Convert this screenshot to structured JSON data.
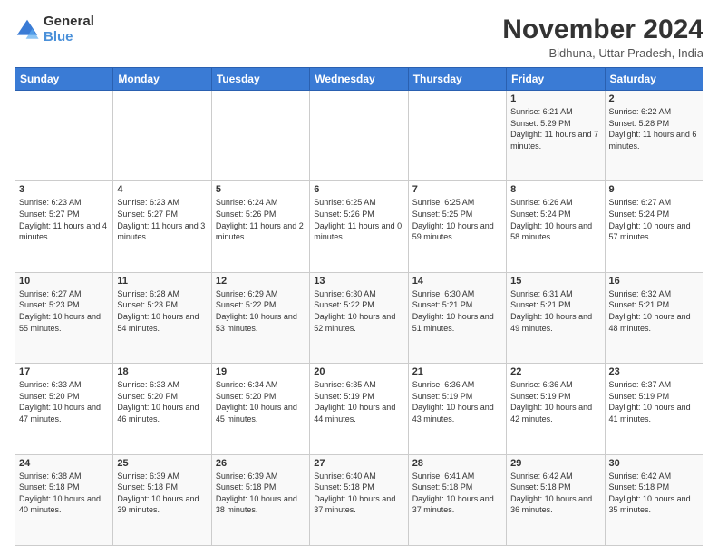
{
  "logo": {
    "general": "General",
    "blue": "Blue"
  },
  "title": "November 2024",
  "location": "Bidhuna, Uttar Pradesh, India",
  "days_of_week": [
    "Sunday",
    "Monday",
    "Tuesday",
    "Wednesday",
    "Thursday",
    "Friday",
    "Saturday"
  ],
  "weeks": [
    [
      {
        "day": "",
        "info": ""
      },
      {
        "day": "",
        "info": ""
      },
      {
        "day": "",
        "info": ""
      },
      {
        "day": "",
        "info": ""
      },
      {
        "day": "",
        "info": ""
      },
      {
        "day": "1",
        "info": "Sunrise: 6:21 AM\nSunset: 5:29 PM\nDaylight: 11 hours and 7 minutes."
      },
      {
        "day": "2",
        "info": "Sunrise: 6:22 AM\nSunset: 5:28 PM\nDaylight: 11 hours and 6 minutes."
      }
    ],
    [
      {
        "day": "3",
        "info": "Sunrise: 6:23 AM\nSunset: 5:27 PM\nDaylight: 11 hours and 4 minutes."
      },
      {
        "day": "4",
        "info": "Sunrise: 6:23 AM\nSunset: 5:27 PM\nDaylight: 11 hours and 3 minutes."
      },
      {
        "day": "5",
        "info": "Sunrise: 6:24 AM\nSunset: 5:26 PM\nDaylight: 11 hours and 2 minutes."
      },
      {
        "day": "6",
        "info": "Sunrise: 6:25 AM\nSunset: 5:26 PM\nDaylight: 11 hours and 0 minutes."
      },
      {
        "day": "7",
        "info": "Sunrise: 6:25 AM\nSunset: 5:25 PM\nDaylight: 10 hours and 59 minutes."
      },
      {
        "day": "8",
        "info": "Sunrise: 6:26 AM\nSunset: 5:24 PM\nDaylight: 10 hours and 58 minutes."
      },
      {
        "day": "9",
        "info": "Sunrise: 6:27 AM\nSunset: 5:24 PM\nDaylight: 10 hours and 57 minutes."
      }
    ],
    [
      {
        "day": "10",
        "info": "Sunrise: 6:27 AM\nSunset: 5:23 PM\nDaylight: 10 hours and 55 minutes."
      },
      {
        "day": "11",
        "info": "Sunrise: 6:28 AM\nSunset: 5:23 PM\nDaylight: 10 hours and 54 minutes."
      },
      {
        "day": "12",
        "info": "Sunrise: 6:29 AM\nSunset: 5:22 PM\nDaylight: 10 hours and 53 minutes."
      },
      {
        "day": "13",
        "info": "Sunrise: 6:30 AM\nSunset: 5:22 PM\nDaylight: 10 hours and 52 minutes."
      },
      {
        "day": "14",
        "info": "Sunrise: 6:30 AM\nSunset: 5:21 PM\nDaylight: 10 hours and 51 minutes."
      },
      {
        "day": "15",
        "info": "Sunrise: 6:31 AM\nSunset: 5:21 PM\nDaylight: 10 hours and 49 minutes."
      },
      {
        "day": "16",
        "info": "Sunrise: 6:32 AM\nSunset: 5:21 PM\nDaylight: 10 hours and 48 minutes."
      }
    ],
    [
      {
        "day": "17",
        "info": "Sunrise: 6:33 AM\nSunset: 5:20 PM\nDaylight: 10 hours and 47 minutes."
      },
      {
        "day": "18",
        "info": "Sunrise: 6:33 AM\nSunset: 5:20 PM\nDaylight: 10 hours and 46 minutes."
      },
      {
        "day": "19",
        "info": "Sunrise: 6:34 AM\nSunset: 5:20 PM\nDaylight: 10 hours and 45 minutes."
      },
      {
        "day": "20",
        "info": "Sunrise: 6:35 AM\nSunset: 5:19 PM\nDaylight: 10 hours and 44 minutes."
      },
      {
        "day": "21",
        "info": "Sunrise: 6:36 AM\nSunset: 5:19 PM\nDaylight: 10 hours and 43 minutes."
      },
      {
        "day": "22",
        "info": "Sunrise: 6:36 AM\nSunset: 5:19 PM\nDaylight: 10 hours and 42 minutes."
      },
      {
        "day": "23",
        "info": "Sunrise: 6:37 AM\nSunset: 5:19 PM\nDaylight: 10 hours and 41 minutes."
      }
    ],
    [
      {
        "day": "24",
        "info": "Sunrise: 6:38 AM\nSunset: 5:18 PM\nDaylight: 10 hours and 40 minutes."
      },
      {
        "day": "25",
        "info": "Sunrise: 6:39 AM\nSunset: 5:18 PM\nDaylight: 10 hours and 39 minutes."
      },
      {
        "day": "26",
        "info": "Sunrise: 6:39 AM\nSunset: 5:18 PM\nDaylight: 10 hours and 38 minutes."
      },
      {
        "day": "27",
        "info": "Sunrise: 6:40 AM\nSunset: 5:18 PM\nDaylight: 10 hours and 37 minutes."
      },
      {
        "day": "28",
        "info": "Sunrise: 6:41 AM\nSunset: 5:18 PM\nDaylight: 10 hours and 37 minutes."
      },
      {
        "day": "29",
        "info": "Sunrise: 6:42 AM\nSunset: 5:18 PM\nDaylight: 10 hours and 36 minutes."
      },
      {
        "day": "30",
        "info": "Sunrise: 6:42 AM\nSunset: 5:18 PM\nDaylight: 10 hours and 35 minutes."
      }
    ]
  ]
}
